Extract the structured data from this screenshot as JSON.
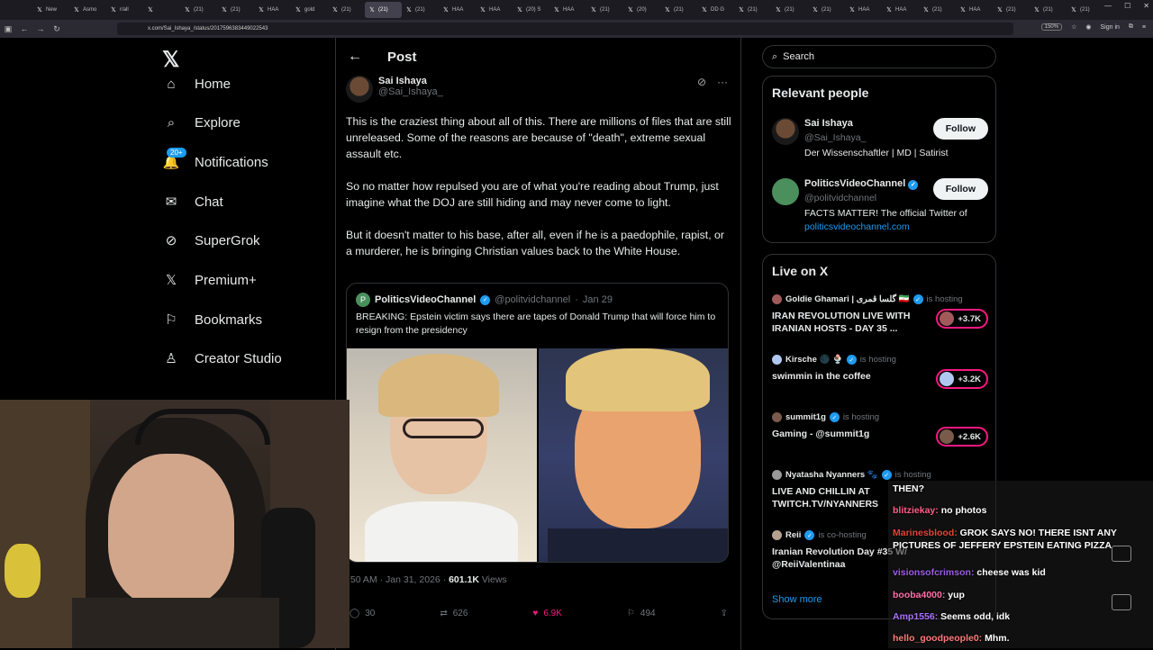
{
  "browser": {
    "tabs": [
      {
        "label": "New",
        "active": false
      },
      {
        "label": "Asmo",
        "active": false
      },
      {
        "label": "r/all",
        "active": false
      },
      {
        "label": "",
        "active": false
      },
      {
        "label": "(21) ",
        "active": false
      },
      {
        "label": "(21) ",
        "active": false
      },
      {
        "label": "HAA",
        "active": false
      },
      {
        "label": "gold",
        "active": false
      },
      {
        "label": "(21) ",
        "active": false
      },
      {
        "label": "(21) ",
        "active": true
      },
      {
        "label": "(21) ",
        "active": false
      },
      {
        "label": "HAA",
        "active": false
      },
      {
        "label": "HAA",
        "active": false
      },
      {
        "label": "(20) S",
        "active": false
      },
      {
        "label": "HAA",
        "active": false
      },
      {
        "label": "(21) ",
        "active": false
      },
      {
        "label": "(20) ",
        "active": false
      },
      {
        "label": "(21) ",
        "active": false
      },
      {
        "label": "DD G",
        "active": false
      },
      {
        "label": "(21) ",
        "active": false
      },
      {
        "label": "(21) ",
        "active": false
      },
      {
        "label": "(21) ",
        "active": false
      },
      {
        "label": "HAA",
        "active": false
      },
      {
        "label": "HAA",
        "active": false
      },
      {
        "label": "(21) ",
        "active": false
      },
      {
        "label": "HAA",
        "active": false
      },
      {
        "label": "(21) ",
        "active": false
      },
      {
        "label": "(21) ",
        "active": false
      },
      {
        "label": "(21) ",
        "active": false
      }
    ],
    "url": "x.com/Sai_Ishaya_/status/2017596383449022543",
    "zoom": "150%",
    "sign_in": "Sign in"
  },
  "nav": {
    "items": [
      {
        "label": "Home",
        "icon": "home-icon"
      },
      {
        "label": "Explore",
        "icon": "search-icon"
      },
      {
        "label": "Notifications",
        "icon": "bell-icon",
        "badge": "20+"
      },
      {
        "label": "Chat",
        "icon": "mail-icon"
      },
      {
        "label": "SuperGrok",
        "icon": "grok-icon"
      },
      {
        "label": "Premium+",
        "icon": "x-icon"
      },
      {
        "label": "Bookmarks",
        "icon": "bookmark-icon"
      },
      {
        "label": "Creator Studio",
        "icon": "creator-icon"
      }
    ]
  },
  "post": {
    "header_title": "Post",
    "author_name": "Sai Ishaya",
    "author_handle": "@Sai_Ishaya_",
    "paragraphs": [
      "This is the craziest thing about all of this. There are millions of files that are still unreleased. Some of the reasons are because of \"death\", extreme sexual assault etc.",
      "So no matter how repulsed you are of what you're reading about Trump, just imagine what the DOJ are still hiding and may never come to light.",
      "But it doesn't matter to his base, after all, even if he is a paedophile, rapist, or a murderer, he is bringing Christian values back to the White House."
    ],
    "quote": {
      "author_name": "PoliticsVideoChannel",
      "author_handle": "@politvidchannel",
      "date": "Jan 29",
      "text": "BREAKING: Epstein victim says there are tapes of Donald Trump that will force him to resign from the presidency"
    },
    "meta_time": ":50 AM · Jan 31, 2026 · ",
    "views_count": "601.1K",
    "views_label": " Views",
    "replies": "30",
    "reposts": "626",
    "likes": "6.9K",
    "bookmarks": "494",
    "colors": {
      "like": "#f91880",
      "accent": "#1d9bf0"
    }
  },
  "sidebar": {
    "search_placeholder": "Search",
    "relevant_title": "Relevant people",
    "people": [
      {
        "name": "Sai Ishaya",
        "handle": "@Sai_Ishaya_",
        "bio": "Der Wissenschaftler | MD | Satirist",
        "link": "",
        "follow": "Follow",
        "verified": false
      },
      {
        "name": "PoliticsVideoChannel",
        "handle": "@politvidchannel",
        "bio": "FACTS MATTER! The official Twitter of ",
        "link": "politicsvideochannel.com",
        "follow": "Follow",
        "verified": true
      }
    ],
    "live_title": "Live on X",
    "live": [
      {
        "host": "Goldie Ghamari | گلسا قمری 🇮🇷",
        "status": "is hosting",
        "title": "IRAN REVOLUTION LIVE WITH IRANIAN HOSTS - DAY 35 ...",
        "count": "+3.7K"
      },
      {
        "host": "Kirsche 🌑 🍨",
        "status": "is hosting",
        "title": "swimmin in the coffee",
        "count": "+3.2K"
      },
      {
        "host": "summit1g",
        "status": "is hosting",
        "title": "Gaming - @summit1g",
        "count": "+2.6K"
      },
      {
        "host": "Nyatasha Nyanners 🐾",
        "status": "is hosting",
        "title": "LIVE AND CHILLIN AT TWITCH.TV/NYANNERS",
        "count": ""
      },
      {
        "host": "Reii",
        "status": "is co-hosting",
        "title": "Iranian Revolution Day #35 W/ @ReiiValentinaa",
        "count": ""
      }
    ],
    "show_more": "Show more"
  },
  "chat": {
    "messages": [
      {
        "user": "",
        "text": "THEN?",
        "color": "#ffffff"
      },
      {
        "user": "blitziekay:",
        "text": " no photos",
        "color": "#ff5e8a"
      },
      {
        "user": "Marinesblood:",
        "text": " GROK SAYS NO! THERE ISNT ANY PICTURES OF JEFFERY EPSTEIN EATING PIZZA",
        "color": "#e0443a"
      },
      {
        "user": "visionsofcrimson:",
        "text": " cheese was kid",
        "color": "#9b5de5"
      },
      {
        "user": "booba4000:",
        "text": " yup",
        "color": "#ff6fa8"
      },
      {
        "user": "Amp1556:",
        "text": " Seems odd, idk",
        "color": "#a970ff"
      },
      {
        "user": "hello_goodpeople0:",
        "text": " Mhm.",
        "color": "#ff7a7a"
      }
    ]
  }
}
